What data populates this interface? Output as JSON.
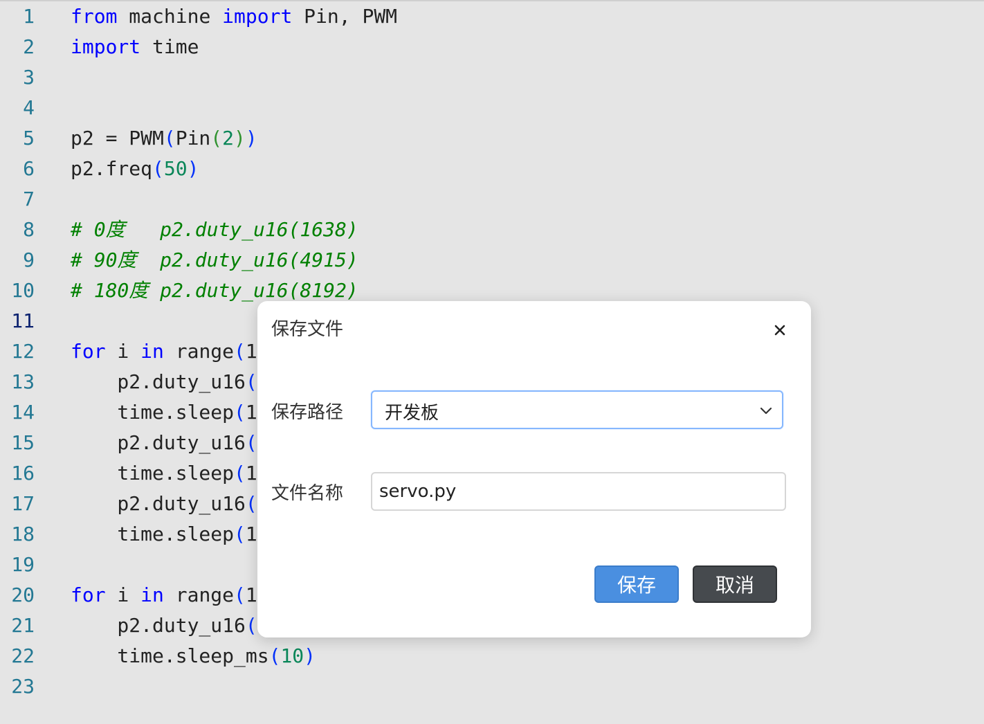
{
  "editor": {
    "lines": [
      {
        "num": "1",
        "tokens": [
          {
            "t": "from",
            "c": "kw"
          },
          {
            "t": " machine ",
            "c": ""
          },
          {
            "t": "import",
            "c": "kw"
          },
          {
            "t": " Pin, PWM",
            "c": ""
          }
        ]
      },
      {
        "num": "2",
        "tokens": [
          {
            "t": "import",
            "c": "kw"
          },
          {
            "t": " time",
            "c": ""
          }
        ]
      },
      {
        "num": "3",
        "tokens": []
      },
      {
        "num": "4",
        "tokens": []
      },
      {
        "num": "5",
        "tokens": [
          {
            "t": "p2 = PWM",
            "c": ""
          },
          {
            "t": "(",
            "c": "br1"
          },
          {
            "t": "Pin",
            "c": ""
          },
          {
            "t": "(",
            "c": "br2"
          },
          {
            "t": "2",
            "c": "num"
          },
          {
            "t": ")",
            "c": "br2"
          },
          {
            "t": ")",
            "c": "br1"
          }
        ]
      },
      {
        "num": "6",
        "tokens": [
          {
            "t": "p2.freq",
            "c": ""
          },
          {
            "t": "(",
            "c": "br1"
          },
          {
            "t": "50",
            "c": "num"
          },
          {
            "t": ")",
            "c": "br1"
          }
        ]
      },
      {
        "num": "7",
        "tokens": []
      },
      {
        "num": "8",
        "tokens": [
          {
            "t": "# 0度   p2.duty_u16(1638)",
            "c": "cm"
          }
        ]
      },
      {
        "num": "9",
        "tokens": [
          {
            "t": "# 90度  p2.duty_u16(4915)",
            "c": "cm"
          }
        ]
      },
      {
        "num": "10",
        "tokens": [
          {
            "t": "# 180度 p2.duty_u16(8192)",
            "c": "cm"
          }
        ]
      },
      {
        "num": "11",
        "active": true,
        "tokens": []
      },
      {
        "num": "12",
        "tokens": [
          {
            "t": "for",
            "c": "kw"
          },
          {
            "t": " i ",
            "c": ""
          },
          {
            "t": "in",
            "c": "kw"
          },
          {
            "t": " range",
            "c": ""
          },
          {
            "t": "(",
            "c": "br1"
          },
          {
            "t": "1",
            "c": ""
          }
        ]
      },
      {
        "num": "13",
        "tokens": [
          {
            "t": "    p2.duty_u16",
            "c": ""
          },
          {
            "t": "(",
            "c": "br1"
          }
        ]
      },
      {
        "num": "14",
        "tokens": [
          {
            "t": "    time.sleep",
            "c": ""
          },
          {
            "t": "(",
            "c": "br1"
          },
          {
            "t": "1",
            "c": ""
          }
        ]
      },
      {
        "num": "15",
        "tokens": [
          {
            "t": "    p2.duty_u16",
            "c": ""
          },
          {
            "t": "(",
            "c": "br1"
          }
        ]
      },
      {
        "num": "16",
        "tokens": [
          {
            "t": "    time.sleep",
            "c": ""
          },
          {
            "t": "(",
            "c": "br1"
          },
          {
            "t": "1",
            "c": ""
          }
        ]
      },
      {
        "num": "17",
        "tokens": [
          {
            "t": "    p2.duty_u16",
            "c": ""
          },
          {
            "t": "(",
            "c": "br1"
          }
        ]
      },
      {
        "num": "18",
        "tokens": [
          {
            "t": "    time.sleep",
            "c": ""
          },
          {
            "t": "(",
            "c": "br1"
          },
          {
            "t": "1",
            "c": ""
          }
        ]
      },
      {
        "num": "19",
        "tokens": []
      },
      {
        "num": "20",
        "tokens": [
          {
            "t": "for",
            "c": "kw"
          },
          {
            "t": " i ",
            "c": ""
          },
          {
            "t": "in",
            "c": "kw"
          },
          {
            "t": " range",
            "c": ""
          },
          {
            "t": "(",
            "c": "br1"
          },
          {
            "t": "1",
            "c": ""
          }
        ]
      },
      {
        "num": "21",
        "tokens": [
          {
            "t": "    p2.duty_u16",
            "c": ""
          },
          {
            "t": "(",
            "c": "br1"
          }
        ]
      },
      {
        "num": "22",
        "tokens": [
          {
            "t": "    time.sleep_ms",
            "c": ""
          },
          {
            "t": "(",
            "c": "br1"
          },
          {
            "t": "10",
            "c": "num"
          },
          {
            "t": ")",
            "c": "br1"
          }
        ]
      },
      {
        "num": "23",
        "tokens": []
      }
    ]
  },
  "dialog": {
    "title": "保存文件",
    "close_icon": "close-icon",
    "path_label": "保存路径",
    "path_value": "开发板",
    "path_icon": "chevron-down-icon",
    "name_label": "文件名称",
    "name_value": "servo.py",
    "save_label": "保存",
    "cancel_label": "取消"
  },
  "colors": {
    "editor_bg": "#e5e5e5",
    "keyword": "#0000ff",
    "comment": "#008000",
    "number": "#098658",
    "line_number": "#237893",
    "save_button": "#4a8fe0",
    "cancel_button": "#464a4e",
    "select_focus_border": "#86b7fe"
  }
}
